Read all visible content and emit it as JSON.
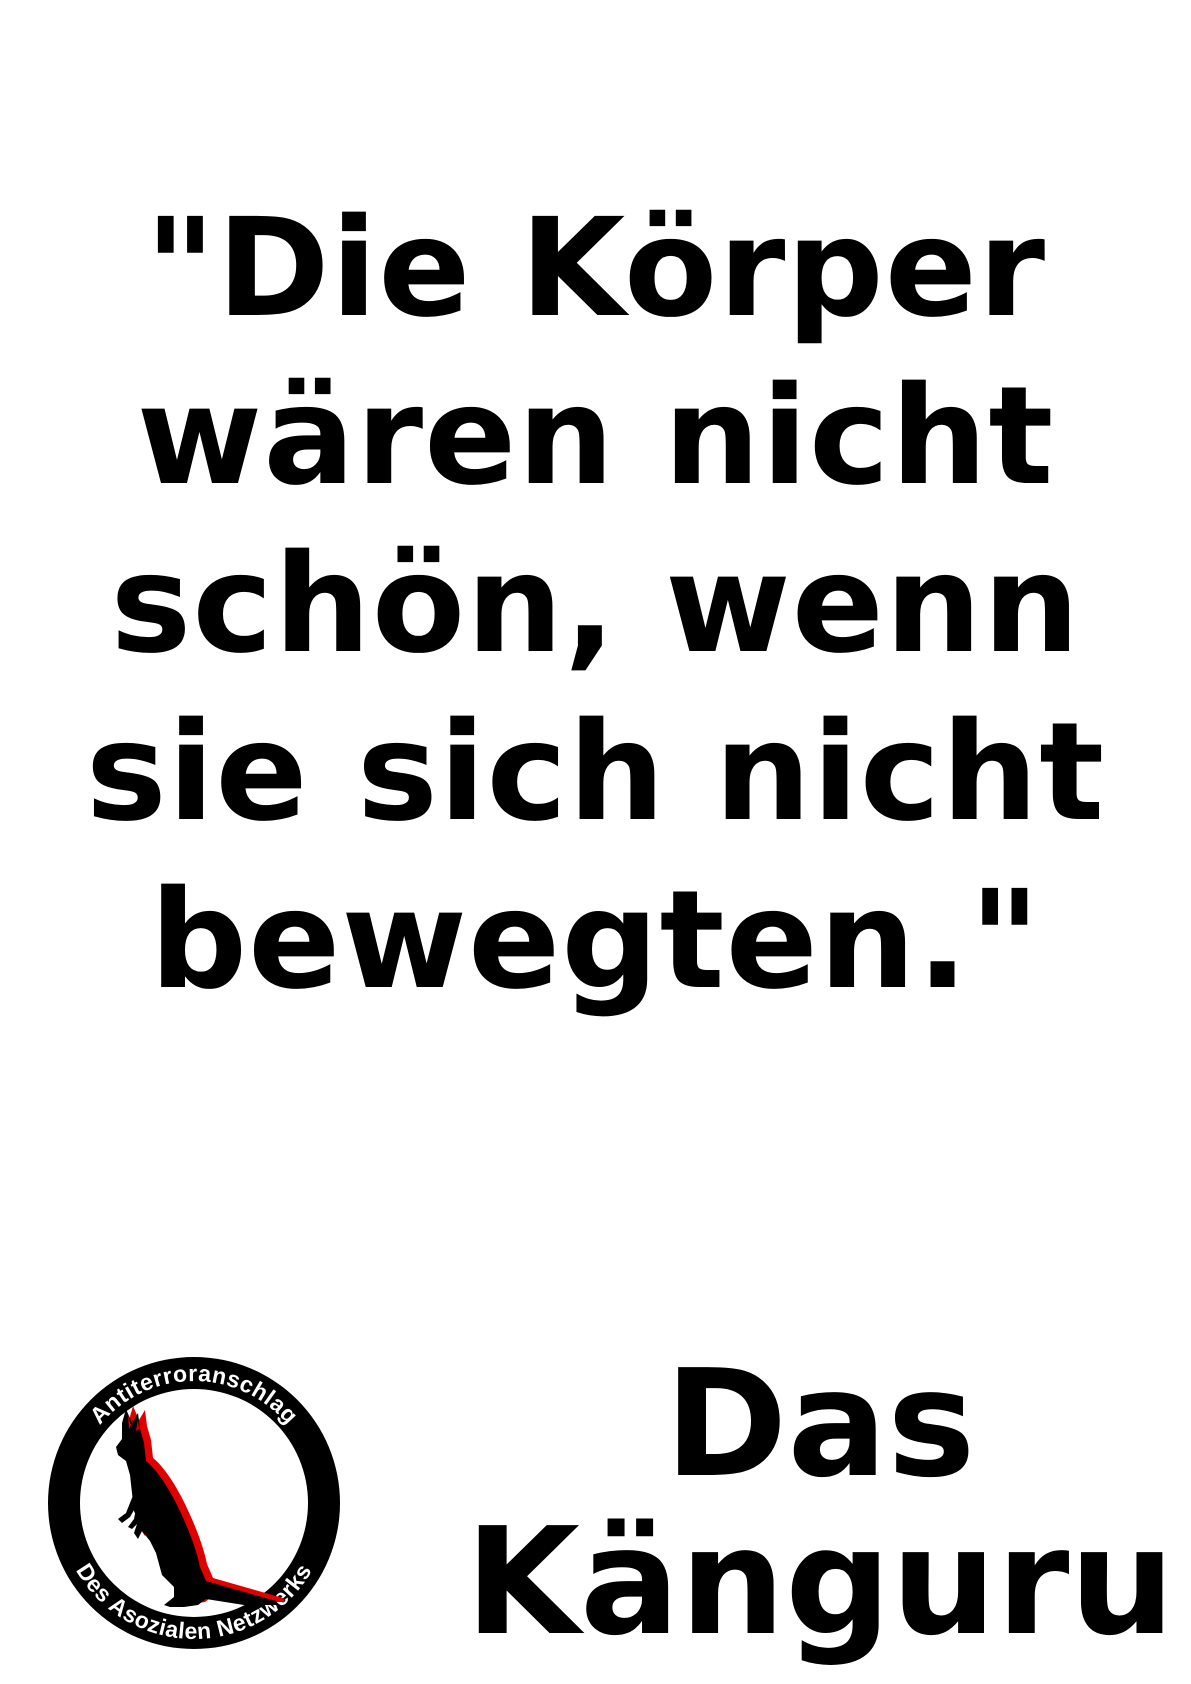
{
  "quote": {
    "lines": [
      "\"Die Körper",
      "wären nicht",
      "schön, wenn",
      "sie sich nicht",
      "bewegten.\""
    ]
  },
  "attribution": {
    "lines": [
      "Das",
      "Känguru"
    ]
  },
  "logo": {
    "top_text": "Antiterroranschlag",
    "bottom_text": "Des Asozialen Netzwerks",
    "icon": "kangaroo-silhouette-icon",
    "colors": {
      "ring": "#000000",
      "kangaroo": "#000000",
      "accent": "#e00000",
      "ring_text": "#ffffff"
    }
  }
}
